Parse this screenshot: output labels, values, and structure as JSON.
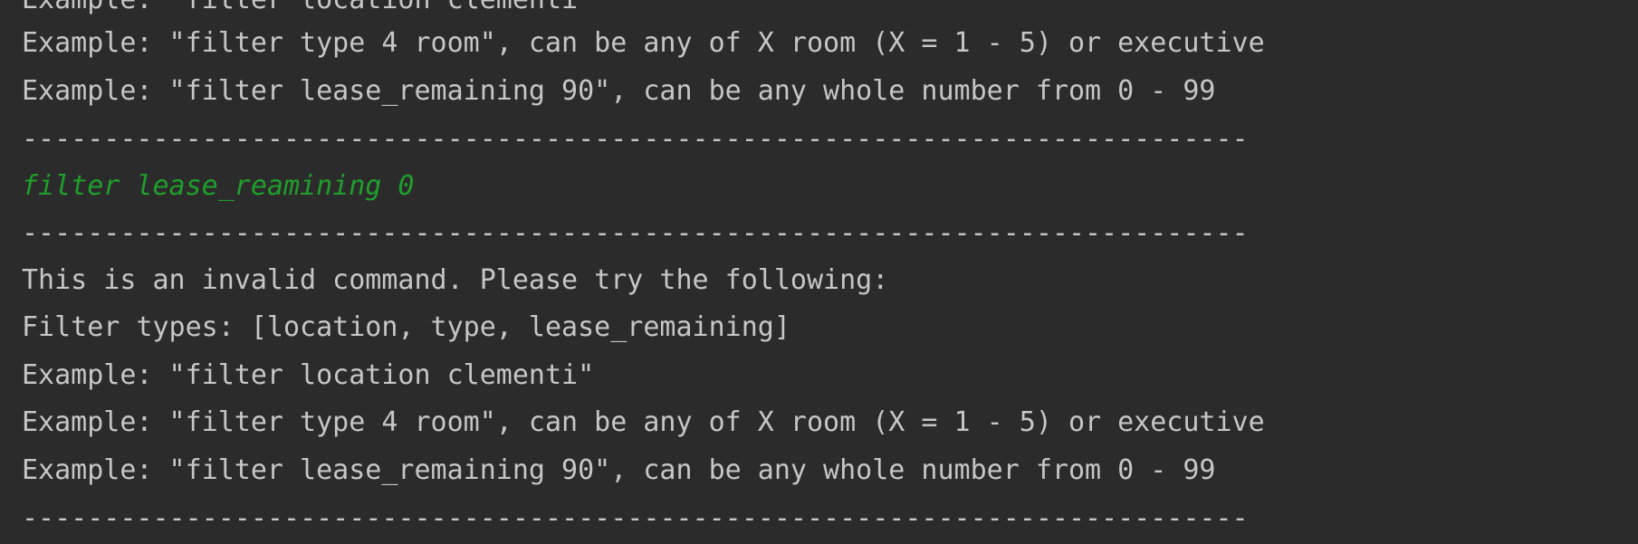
{
  "console": {
    "lines": [
      {
        "kind": "output",
        "text": "Example: \"filter location clementi\""
      },
      {
        "kind": "output",
        "text": "Example: \"filter type 4 room\", can be any of X room (X = 1 - 5) or executive"
      },
      {
        "kind": "output",
        "text": "Example: \"filter lease_remaining 90\", can be any whole number from 0 - 99"
      },
      {
        "kind": "separator",
        "text": "---------------------------------------------------------------------------"
      },
      {
        "kind": "input",
        "text": "filter lease_reamining 0"
      },
      {
        "kind": "separator",
        "text": "---------------------------------------------------------------------------"
      },
      {
        "kind": "output",
        "text": "This is an invalid command. Please try the following:"
      },
      {
        "kind": "output",
        "text": "Filter types: [location, type, lease_remaining]"
      },
      {
        "kind": "output",
        "text": "Example: \"filter location clementi\""
      },
      {
        "kind": "output",
        "text": "Example: \"filter type 4 room\", can be any of X room (X = 1 - 5) or executive"
      },
      {
        "kind": "output",
        "text": "Example: \"filter lease_remaining 90\", can be any whole number from 0 - 99"
      },
      {
        "kind": "separator",
        "text": "---------------------------------------------------------------------------"
      }
    ]
  }
}
